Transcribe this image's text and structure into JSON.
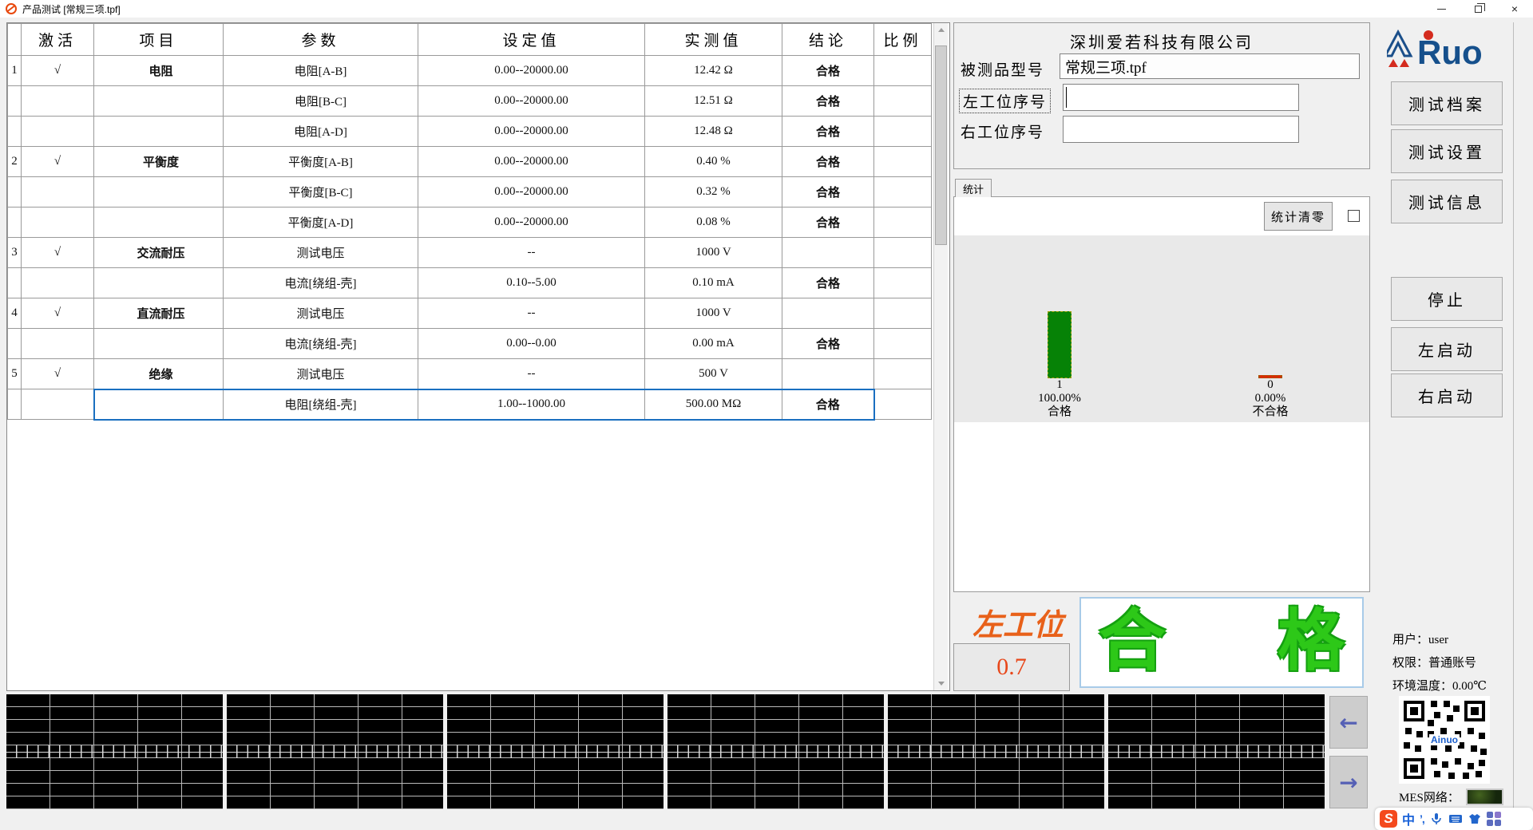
{
  "window": {
    "title": "产品测试 [常规三项.tpf]"
  },
  "table": {
    "headers": {
      "activate": "激活",
      "item": "项目",
      "param": "参数",
      "set": "设定值",
      "measured": "实测值",
      "result": "结论",
      "ratio": "比例"
    },
    "rows": [
      {
        "num": "1",
        "check": "√",
        "item": "电阻",
        "param": "电阻[A-B]",
        "set": "0.00--20000.00",
        "measured": "12.42 Ω",
        "result": "合格",
        "ratio": ""
      },
      {
        "num": "",
        "check": "",
        "item": "",
        "param": "电阻[B-C]",
        "set": "0.00--20000.00",
        "measured": "12.51 Ω",
        "result": "合格",
        "ratio": ""
      },
      {
        "num": "",
        "check": "",
        "item": "",
        "param": "电阻[A-D]",
        "set": "0.00--20000.00",
        "measured": "12.48 Ω",
        "result": "合格",
        "ratio": ""
      },
      {
        "num": "2",
        "check": "√",
        "item": "平衡度",
        "param": "平衡度[A-B]",
        "set": "0.00--20000.00",
        "measured": "0.40 %",
        "result": "合格",
        "ratio": ""
      },
      {
        "num": "",
        "check": "",
        "item": "",
        "param": "平衡度[B-C]",
        "set": "0.00--20000.00",
        "measured": "0.32 %",
        "result": "合格",
        "ratio": ""
      },
      {
        "num": "",
        "check": "",
        "item": "",
        "param": "平衡度[A-D]",
        "set": "0.00--20000.00",
        "measured": "0.08 %",
        "result": "合格",
        "ratio": ""
      },
      {
        "num": "3",
        "check": "√",
        "item": "交流耐压",
        "param": "测试电压",
        "set": "--",
        "measured": "1000 V",
        "result": "",
        "ratio": ""
      },
      {
        "num": "",
        "check": "",
        "item": "",
        "param": "电流[绕组-壳]",
        "set": "0.10--5.00",
        "measured": "0.10 mA",
        "result": "合格",
        "ratio": ""
      },
      {
        "num": "4",
        "check": "√",
        "item": "直流耐压",
        "param": "测试电压",
        "set": "--",
        "measured": "1000 V",
        "result": "",
        "ratio": ""
      },
      {
        "num": "",
        "check": "",
        "item": "",
        "param": "电流[绕组-壳]",
        "set": "0.00--0.00",
        "measured": "0.00 mA",
        "result": "合格",
        "ratio": ""
      },
      {
        "num": "5",
        "check": "√",
        "item": "绝缘",
        "param": "测试电压",
        "set": "--",
        "measured": "500 V",
        "result": "",
        "ratio": ""
      },
      {
        "num": "",
        "check": "",
        "item": "",
        "param": "电阻[绕组-壳]",
        "set": "1.00--1000.00",
        "measured": "500.00 MΩ",
        "result": "合格",
        "ratio": "",
        "selected": true
      }
    ]
  },
  "info": {
    "company": "深圳爱若科技有限公司",
    "model_label": "被测品型号",
    "model_value": "常规三项.tpf",
    "left_sn_label": "左工位序号",
    "left_sn_value": "",
    "right_sn_label": "右工位序号",
    "right_sn_value": ""
  },
  "stats": {
    "tab_label": "统计",
    "clear_button": "统计清零"
  },
  "chart_data": {
    "type": "bar",
    "categories": [
      "合格",
      "不合格"
    ],
    "values": [
      1,
      0
    ],
    "counts": [
      "1",
      "0"
    ],
    "percents": [
      "100.00%",
      "0.00%"
    ],
    "colors": [
      "#068206",
      "#d92b00"
    ],
    "ylim": [
      0,
      1
    ],
    "title": "",
    "xlabel": "",
    "ylabel": ""
  },
  "station": {
    "label": "左工位",
    "value": "0.7",
    "result": "合格"
  },
  "sidebar": {
    "logo_text": "Ruo",
    "buttons": [
      {
        "label": "测试档案"
      },
      {
        "label": "测试设置"
      },
      {
        "label": "测试信息"
      },
      {
        "label": "停止"
      },
      {
        "label": "左启动"
      },
      {
        "label": "右启动"
      }
    ],
    "user_label": "用户：",
    "user_value": "user",
    "perm_label": "权限：",
    "perm_value": "普通账号",
    "temp_label": "环境温度：",
    "temp_value": "0.00℃",
    "qr_center": "Ainuo",
    "mes_label": "MES网络："
  },
  "taskbar": {
    "ime_letter": "S",
    "lang": "中",
    "punct": "’,"
  },
  "scope": {
    "prev": "←",
    "next": "→"
  }
}
